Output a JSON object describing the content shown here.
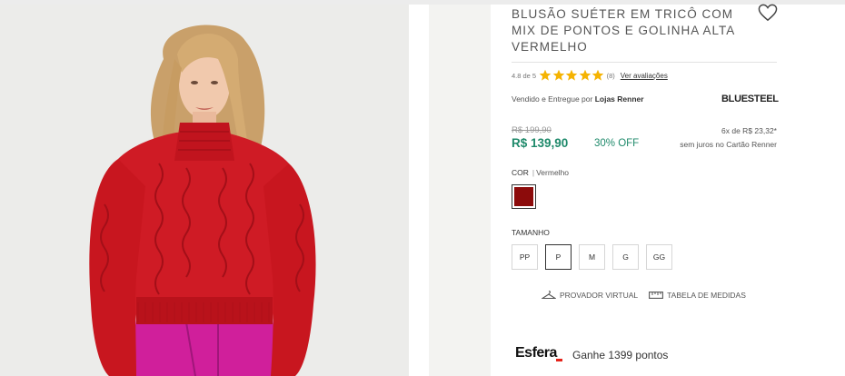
{
  "product": {
    "title": "BLUSÃO SUÉTER EM TRICÔ COM MIX DE PONTOS E GOLINHA ALTA VERMELHO",
    "image_alt_icon": "product-photo"
  },
  "rating": {
    "score_text": "4.8 de 5",
    "stars": 5,
    "count_text": "(8)",
    "reviews_link": "Ver avaliações",
    "star_color": "#f5b301"
  },
  "seller": {
    "prefix": "Vendido e Entregue por",
    "name": "Lojas Renner",
    "brand": "BLUESTEEL"
  },
  "pricing": {
    "old_price": "R$ 199,90",
    "price": "R$ 139,90",
    "discount": "30% OFF",
    "installments": "6x de R$ 23,32*",
    "installments_note": "sem juros no Cartão Renner",
    "price_color": "#1f8a6b"
  },
  "color": {
    "label": "COR",
    "value": "Vermelho",
    "swatch_hex": "#8c0b0b"
  },
  "size": {
    "label": "TAMANHO",
    "options": [
      "PP",
      "P",
      "M",
      "G",
      "GG"
    ],
    "selected": "P"
  },
  "links": {
    "virtual_fitting": "PROVADOR VIRTUAL",
    "size_chart": "TABELA DE MEDIDAS"
  },
  "esfera": {
    "logo": "Esfera",
    "text": "Ganhe 1399 pontos"
  }
}
